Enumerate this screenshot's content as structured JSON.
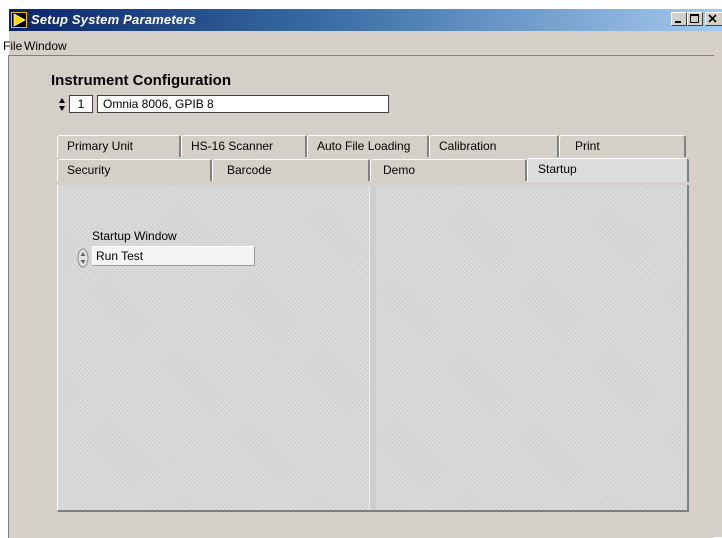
{
  "window": {
    "title": "Setup System Parameters",
    "icon": "labview-run-arrow-icon",
    "controls": [
      "minimize-icon",
      "maximize-icon",
      "close-icon"
    ]
  },
  "menu": {
    "items": [
      "File",
      "Window"
    ]
  },
  "instrument": {
    "section_title": "Instrument Configuration",
    "index": "1",
    "config": "Omnia 8006, GPIB 8"
  },
  "tabs": {
    "row1": [
      "Primary Unit",
      "HS-16 Scanner",
      "Auto File Loading",
      "Calibration",
      "Print"
    ],
    "row2": [
      "Security",
      "Barcode",
      "Demo",
      "Startup"
    ],
    "active": "Startup"
  },
  "startup": {
    "field_label": "Startup Window",
    "field_value": "Run Test"
  },
  "colors": {
    "titlebar_start": "#0a246a",
    "titlebar_end": "#a6caf0",
    "face": "#d4d0c8"
  }
}
